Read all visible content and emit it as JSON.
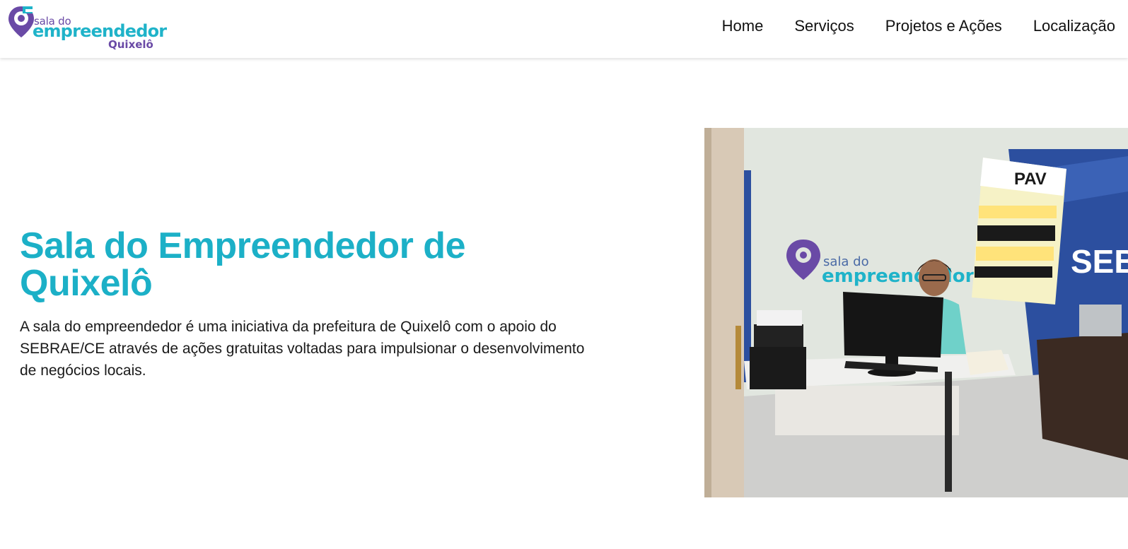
{
  "header": {
    "logo": {
      "line1": "sala do",
      "line2": "empreendedor",
      "line3": "Quixelô"
    },
    "nav": [
      {
        "label": "Home"
      },
      {
        "label": "Serviços"
      },
      {
        "label": "Projetos e Ações"
      },
      {
        "label": "Localização"
      }
    ]
  },
  "hero": {
    "title": "Sala do Empreendedor de Quixelô",
    "description": "A sala do empreendedor é uma iniciativa da prefeitura de Quixelô com o apoio do SEBRAE/CE através de ações gratuitas voltadas para impulsionar o desenvolvimento de negócios locais.",
    "photo": {
      "wall_logo_line1": "sala do",
      "wall_logo_line2": "empreendedor",
      "poster_title": "PAV",
      "banner_text": "SEBRAE"
    }
  },
  "colors": {
    "brand_teal": "#1cb0c7",
    "brand_purple": "#6a4aa6",
    "text": "#1a1a1a"
  }
}
